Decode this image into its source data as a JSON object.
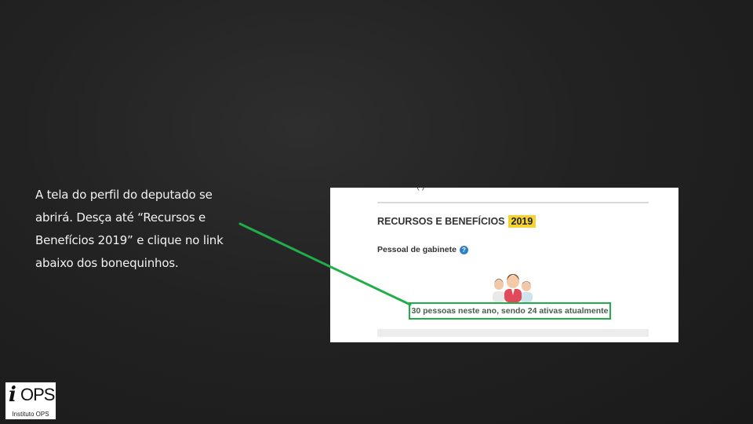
{
  "instruction": {
    "lines": [
      "A tela do perfil do deputado se",
      "abrirá. Desça até “Recursos e",
      "Benefícios 2019” e clique no link",
      "abaixo dos bonequinhos."
    ]
  },
  "screenshot": {
    "section_title": "RECURSOS E BENEFÍCIOS",
    "year": "2019",
    "subsection": "Pessoal de gabinete",
    "help_glyph": "?",
    "staff_link": "30 pessoas neste ano, sendo 24 ativas atualmente",
    "highlight_color": "#1fae48",
    "badge_color": "#f2d234"
  },
  "icons": [
    "help-icon",
    "people-icon",
    "pointer-line"
  ],
  "logo": {
    "mark": "i",
    "word": "OPS",
    "caption": "Instituto OPS"
  }
}
